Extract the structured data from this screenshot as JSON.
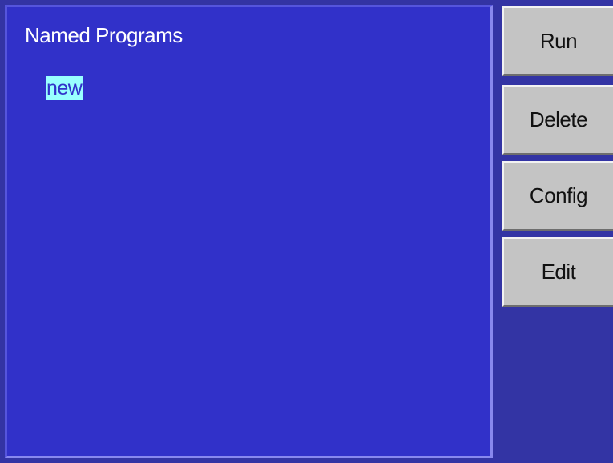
{
  "main_panel": {
    "title": "Named Programs",
    "programs": [
      {
        "label": "new",
        "selected": true
      }
    ]
  },
  "side_buttons": {
    "run": "Run",
    "delete": "Delete",
    "config": "Config",
    "edit": "Edit"
  },
  "colors": {
    "main_panel_bg": "#3131c9",
    "side_panel_bg": "#3334a4",
    "selection_bg": "#99ffff",
    "button_bg": "#c4c4c4"
  }
}
